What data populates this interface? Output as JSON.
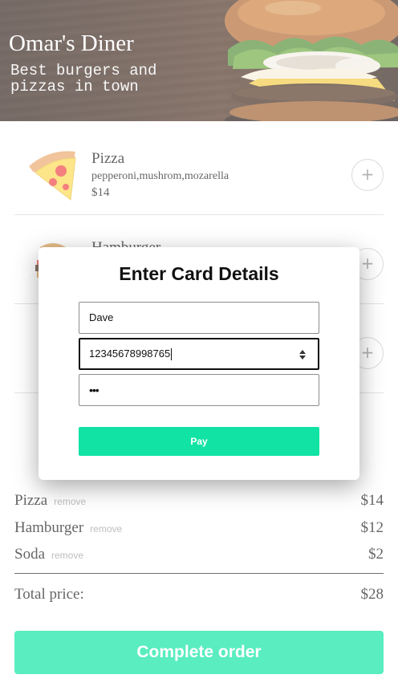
{
  "header": {
    "title": "Omar's Diner",
    "subtitle": "Best burgers and pizzas in town"
  },
  "menu": {
    "items": [
      {
        "name": "Pizza",
        "description": "pepperoni,mushrom,mozarella",
        "price": "$14",
        "add_label": "+",
        "icon": "pizza-icon"
      },
      {
        "name": "Hamburger",
        "description": "",
        "price": "",
        "add_label": "+",
        "icon": "hamburger-icon"
      },
      {
        "name": "",
        "description": "",
        "price": "",
        "add_label": "+",
        "icon": "soda-icon"
      }
    ]
  },
  "order": {
    "rows": [
      {
        "name": "Pizza",
        "remove_label": "remove",
        "price": "$14"
      },
      {
        "name": "Hamburger",
        "remove_label": "remove",
        "price": "$12"
      },
      {
        "name": "Soda",
        "remove_label": "remove",
        "price": "$2"
      }
    ],
    "total_label": "Total price:",
    "total_price": "$28",
    "complete_label": "Complete order"
  },
  "modal": {
    "title": "Enter Card Details",
    "name_value": "Dave",
    "card_value": "12345678998765",
    "cvv_value": "•••",
    "pay_label": "Pay"
  },
  "colors": {
    "accent": "#00e39d",
    "pay_button": "#11e3a4"
  }
}
